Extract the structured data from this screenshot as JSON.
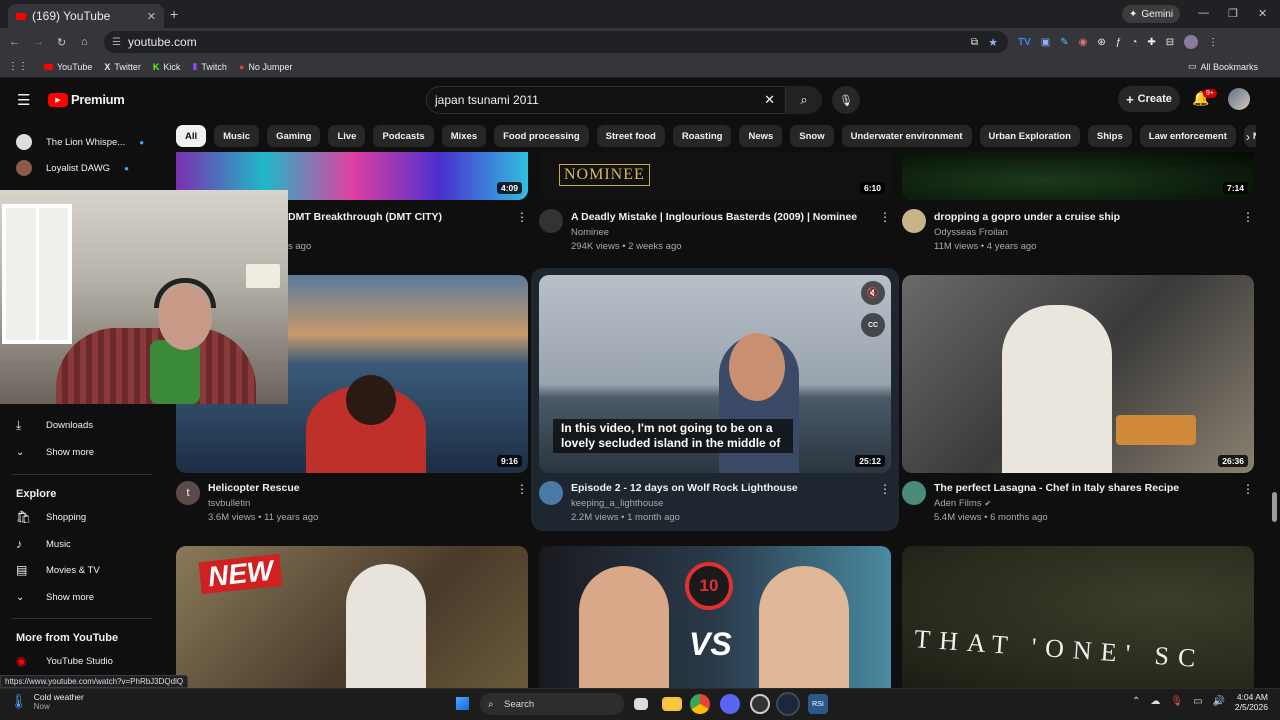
{
  "browser": {
    "tab_title": "(169) YouTube",
    "url": "youtube.com",
    "gemini_label": "Gemini",
    "bookmarks": [
      "YouTube",
      "Twitter",
      "Kick",
      "Twitch",
      "No Jumper"
    ],
    "all_bookmarks": "All Bookmarks",
    "status_url": "https://www.youtube.com/watch?v=PhRbJ3DQdlQ"
  },
  "header": {
    "logo_text": "Premium",
    "search_value": "japan tsunami 2011",
    "create_label": "Create",
    "notif_badge": "9+"
  },
  "chips": [
    "All",
    "Music",
    "Gaming",
    "Live",
    "Podcasts",
    "Mixes",
    "Food processing",
    "Street food",
    "Roasting",
    "News",
    "Snow",
    "Underwater environment",
    "Urban Exploration",
    "Ships",
    "Law enforcement",
    "Nature docum"
  ],
  "sidebar": {
    "subs": [
      {
        "label": "The Lion Whispe..."
      },
      {
        "label": "Loyalist DAWG"
      }
    ],
    "downloads": "Downloads",
    "show_more": "Show more",
    "explore_header": "Explore",
    "explore": [
      "Shopping",
      "Music",
      "Movies & TV",
      "Show more"
    ],
    "more_header": "More from YouTube",
    "studio": "YouTube Studio"
  },
  "videos": [
    {
      "title": "DMT Breakthrough (DMT CITY)",
      "channel": "",
      "meta": "s ago",
      "duration": "4:09"
    },
    {
      "title": "A Deadly Mistake | Inglourious Basterds (2009) | Nominee",
      "channel": "Nominee",
      "meta": "294K views • 2 weeks ago",
      "duration": "6:10",
      "thumb_text": "NOMINEE"
    },
    {
      "title": "dropping a gopro under a cruise ship",
      "channel": "Odysseas Froilan",
      "meta": "11M views • 4 years ago",
      "duration": "7:14"
    },
    {
      "title": "Helicopter Rescue",
      "channel": "tsvbulletin",
      "meta": "3.6M views • 11 years ago",
      "duration": "9:16",
      "avatar_letter": "t"
    },
    {
      "title": "Episode 2 - 12 days on Wolf Rock Lighthouse",
      "channel": "keeping_a_lighthouse",
      "meta": "2.2M views • 1 month ago",
      "duration": "25:12",
      "caption": "In this video, I'm not going to be on a lovely secluded island in the middle of"
    },
    {
      "title": "The perfect Lasagna - Chef in Italy shares Recipe",
      "channel": "Aden Films",
      "meta": "5.4M views • 6 months ago",
      "duration": "26:36"
    }
  ],
  "thumb_texts": {
    "new": "NEW",
    "vs": "VS",
    "ten": "10",
    "that_one": "THAT 'ONE' SC"
  },
  "taskbar": {
    "weather": "Cold weather",
    "weather_sub": "Now",
    "search": "Search",
    "time": "4:04 AM",
    "date": "2/5/2026"
  },
  "colors": {
    "yt_red": "#ff0000",
    "bg": "#0f0f0f",
    "chip": "#272727"
  }
}
